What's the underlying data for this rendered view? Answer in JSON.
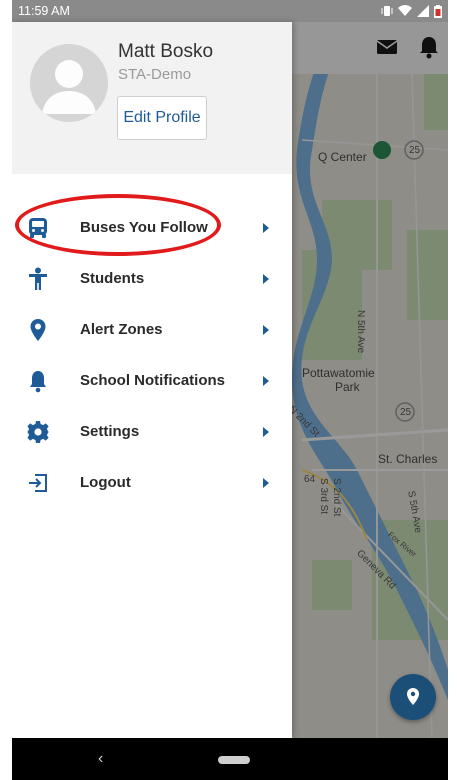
{
  "status_bar": {
    "time": "11:59 AM"
  },
  "colors": {
    "accent": "#1f5b96",
    "menu_icon": "#1f5b96",
    "highlight": "#e11b1b",
    "fab": "#1b4f78"
  },
  "profile": {
    "name": "Matt Bosko",
    "organization": "STA-Demo",
    "edit_button": "Edit Profile"
  },
  "menu": {
    "items": [
      {
        "label": "Buses You Follow",
        "icon": "bus-icon"
      },
      {
        "label": "Students",
        "icon": "student-icon"
      },
      {
        "label": "Alert Zones",
        "icon": "location-pin-icon"
      },
      {
        "label": "School Notifications",
        "icon": "bell-icon"
      },
      {
        "label": "Settings",
        "icon": "gear-icon"
      },
      {
        "label": "Logout",
        "icon": "logout-icon"
      }
    ]
  },
  "map": {
    "labels": {
      "q_center": "Q Center",
      "route_25_top": "25",
      "n_5th_ave": "N 5th Ave",
      "pottawatomie": "Pottawatomie",
      "park": "Park",
      "n_2nd_st": "N 2nd St",
      "route_25_mid": "25",
      "st_charles": "St. Charles",
      "route_64": "64",
      "s_2nd_st": "S 2nd St",
      "s_3rd_st": "S 3rd St",
      "s_5th_ave": "S 5th Ave",
      "fox_river": "Fox River",
      "geneva_rd": "Geneva Rd"
    }
  },
  "header_icons": [
    "mail-icon",
    "bell-icon"
  ],
  "fab": {
    "icon": "location-pin-icon"
  },
  "nav_bar": {
    "back_glyph": "‹"
  }
}
